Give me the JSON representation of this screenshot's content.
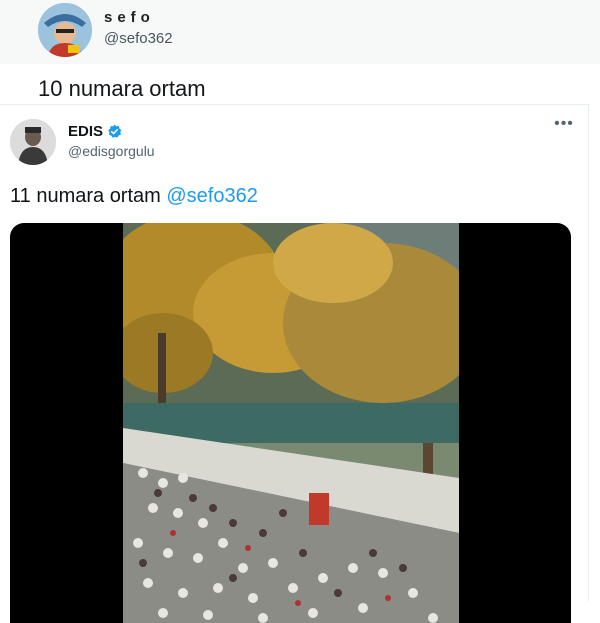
{
  "outer_tweet": {
    "display_name": "sefo",
    "handle": "@sefo362",
    "text": "10 numara ortam"
  },
  "quoted_tweet": {
    "display_name": "EDIS",
    "handle": "@edisgorgulu",
    "verified": true,
    "text_plain": "11 numara ortam ",
    "mention": "@sefo362",
    "more_icon": "ellipsis-icon",
    "media": {
      "type": "video",
      "description_icon": "video-frame"
    }
  },
  "colors": {
    "link": "#1d9bf0",
    "verified": "#1d9bf0",
    "secondary_text": "#536471"
  }
}
